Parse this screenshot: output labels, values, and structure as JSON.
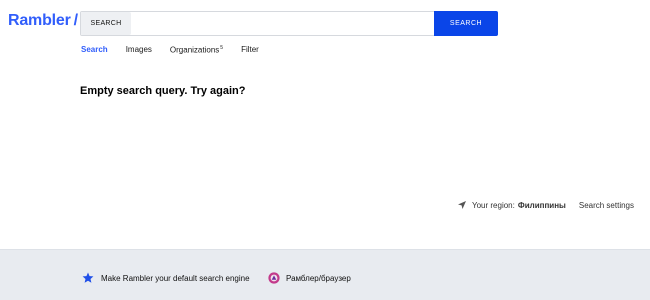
{
  "header": {
    "logo_text": "Rambler",
    "logo_slash": "/",
    "search": {
      "type_label": "SEARCH",
      "query_value": "",
      "button_label": "SEARCH"
    }
  },
  "tabs": [
    {
      "label": "Search",
      "active": true,
      "count": ""
    },
    {
      "label": "Images",
      "active": false,
      "count": ""
    },
    {
      "label": "Organizations",
      "active": false,
      "count": "5"
    },
    {
      "label": "Filter",
      "active": false,
      "count": ""
    }
  ],
  "main": {
    "message": "Empty search query. Try again?"
  },
  "region": {
    "label": "Your region:",
    "value": "Филиппины",
    "settings_link": "Search settings",
    "icon": "navigation-arrow-icon"
  },
  "footer": {
    "default_engine_label": "Make Rambler your default search engine",
    "default_engine_icon": "star-icon",
    "browser_label": "Рамблер/браузер",
    "browser_icon": "rambler-browser-icon"
  },
  "colors": {
    "brand": "#315efb",
    "button": "#0a45e8",
    "footer_bg": "#e8ebf0",
    "browser_icon": "#c33a8b"
  }
}
